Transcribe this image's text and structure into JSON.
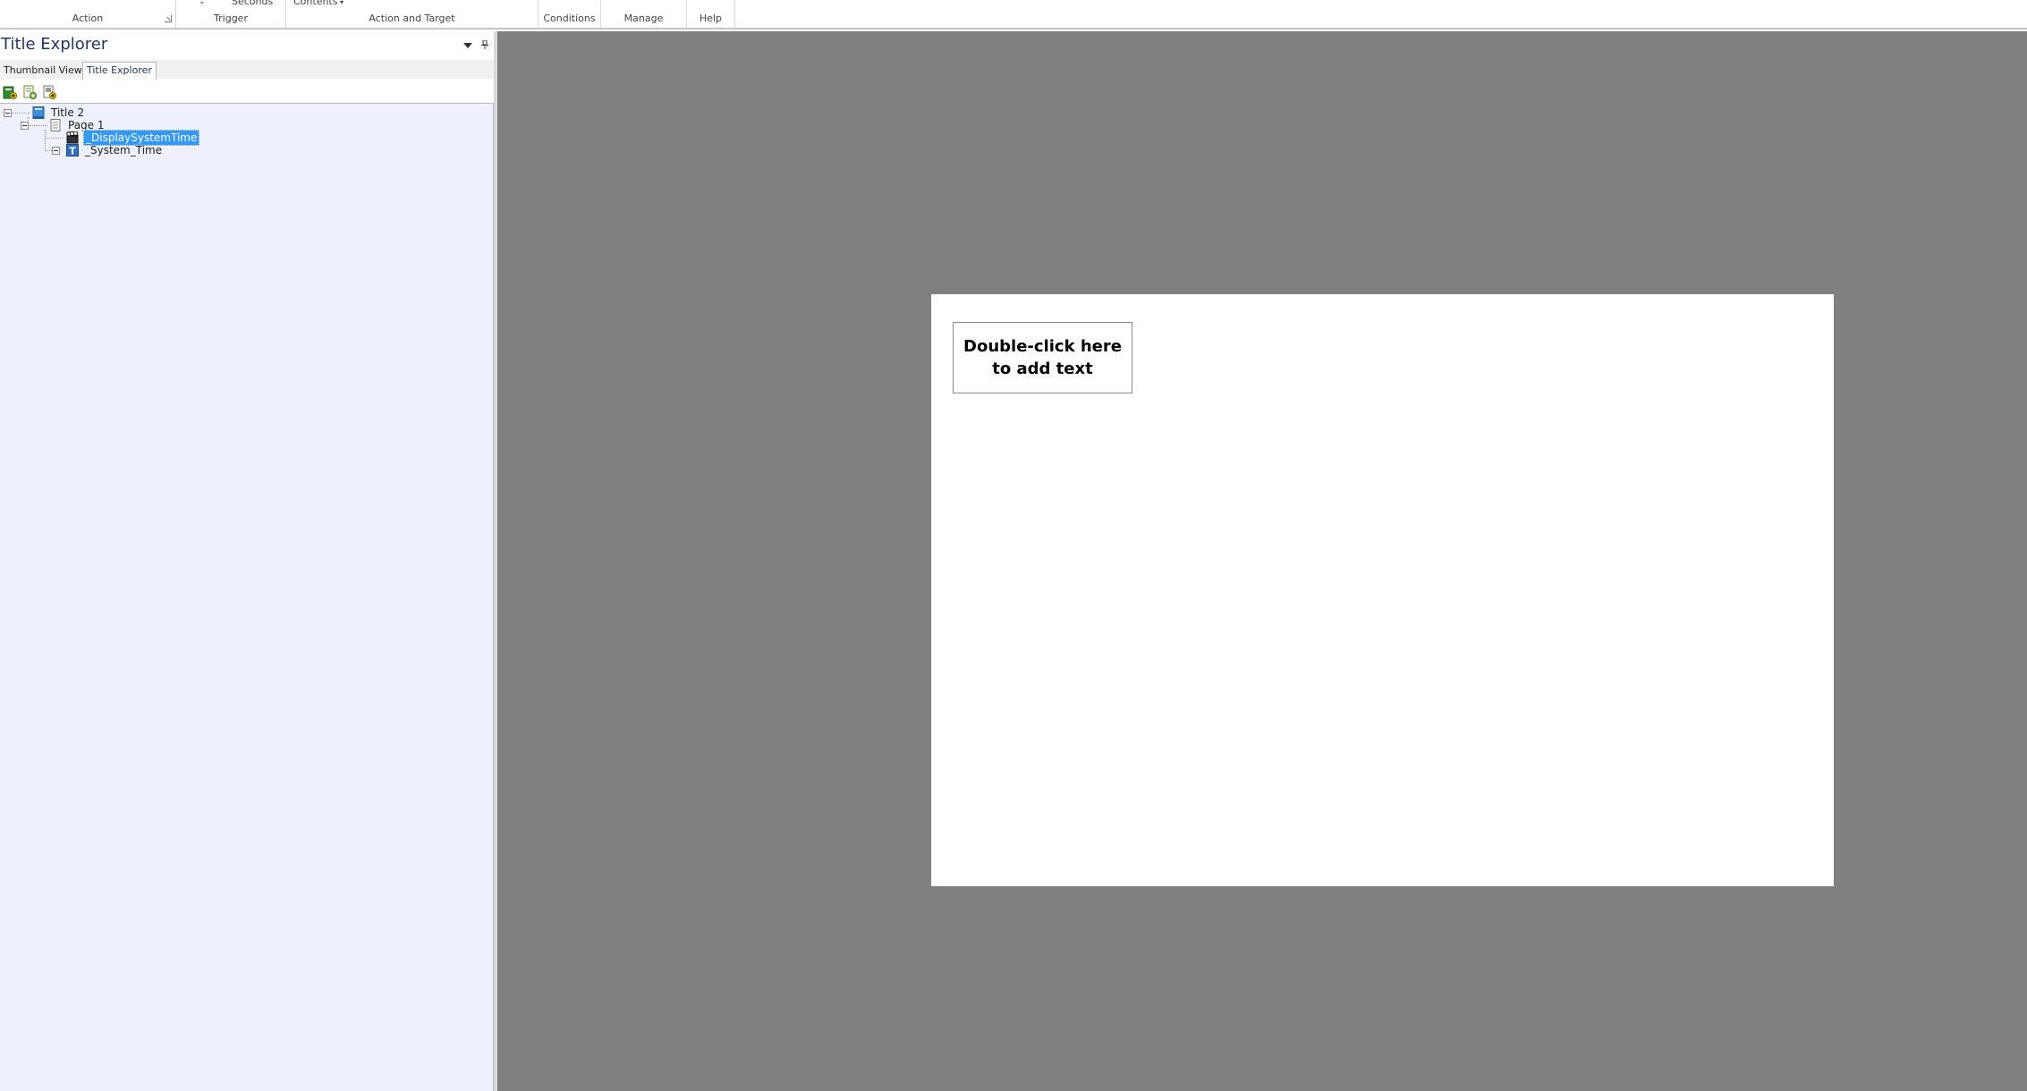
{
  "ribbon": {
    "groups": [
      {
        "label": "Action"
      },
      {
        "label": "Trigger",
        "clipped_text": "Seconds"
      },
      {
        "label": "Action and Target",
        "clipped_text": "Contents"
      },
      {
        "label": "Conditions"
      },
      {
        "label": "Manage"
      },
      {
        "label": "Help"
      }
    ]
  },
  "panel": {
    "title": "Title Explorer",
    "tabs": [
      {
        "label": "Thumbnail View",
        "active": false
      },
      {
        "label": "Title Explorer",
        "active": true
      }
    ],
    "toolbar_icons": [
      "add-title-icon",
      "add-page-icon",
      "add-action-icon"
    ]
  },
  "tree": {
    "nodes": [
      {
        "label": "Title 2",
        "icon": "title-book-icon",
        "expanded": true
      },
      {
        "label": "Page 1",
        "icon": "page-icon",
        "expanded": true
      },
      {
        "label": "_DisplaySystemTime",
        "icon": "clapperboard-icon",
        "selected": true
      },
      {
        "label": "_System_Time",
        "icon": "text-object-icon"
      }
    ]
  },
  "canvas": {
    "textbox_placeholder": "Double-click here to add text"
  },
  "colors": {
    "workspace_bg": "#808080",
    "tree_bg": "#eef0fb",
    "selection": "#3399ff",
    "panel_title": "#1f3864"
  }
}
